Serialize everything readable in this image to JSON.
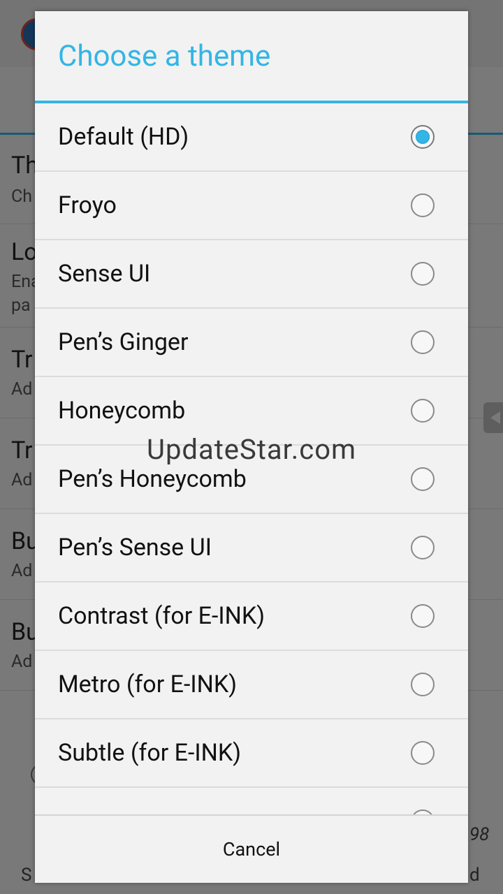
{
  "background": {
    "items": [
      {
        "title": "Th",
        "sub": "Ch"
      },
      {
        "title": "Lo",
        "sub": "Ena",
        "sub2": "pa"
      },
      {
        "title": "Tr",
        "sub": "Ad"
      },
      {
        "title": "Tr",
        "sub": "Ad"
      },
      {
        "title": "Bu",
        "sub": "Ad"
      },
      {
        "title": "Bu",
        "sub": "Ad"
      }
    ],
    "footer_left": "S",
    "footer_right": "d",
    "footer_version": "98"
  },
  "dialog": {
    "title": "Choose a theme",
    "cancel_label": "Cancel",
    "accent_color": "#33b5e5",
    "themes": [
      {
        "label": "Default (HD)",
        "selected": true
      },
      {
        "label": "Froyo",
        "selected": false
      },
      {
        "label": "Sense UI",
        "selected": false
      },
      {
        "label": "Pen’s Ginger",
        "selected": false
      },
      {
        "label": "Honeycomb",
        "selected": false
      },
      {
        "label": "Pen’s Honeycomb",
        "selected": false
      },
      {
        "label": "Pen’s Sense UI",
        "selected": false
      },
      {
        "label": "Contrast (for E-INK)",
        "selected": false
      },
      {
        "label": "Metro (for E-INK)",
        "selected": false
      },
      {
        "label": "Subtle (for E-INK)",
        "selected": false
      }
    ]
  },
  "watermark": "UpdateStar.com"
}
